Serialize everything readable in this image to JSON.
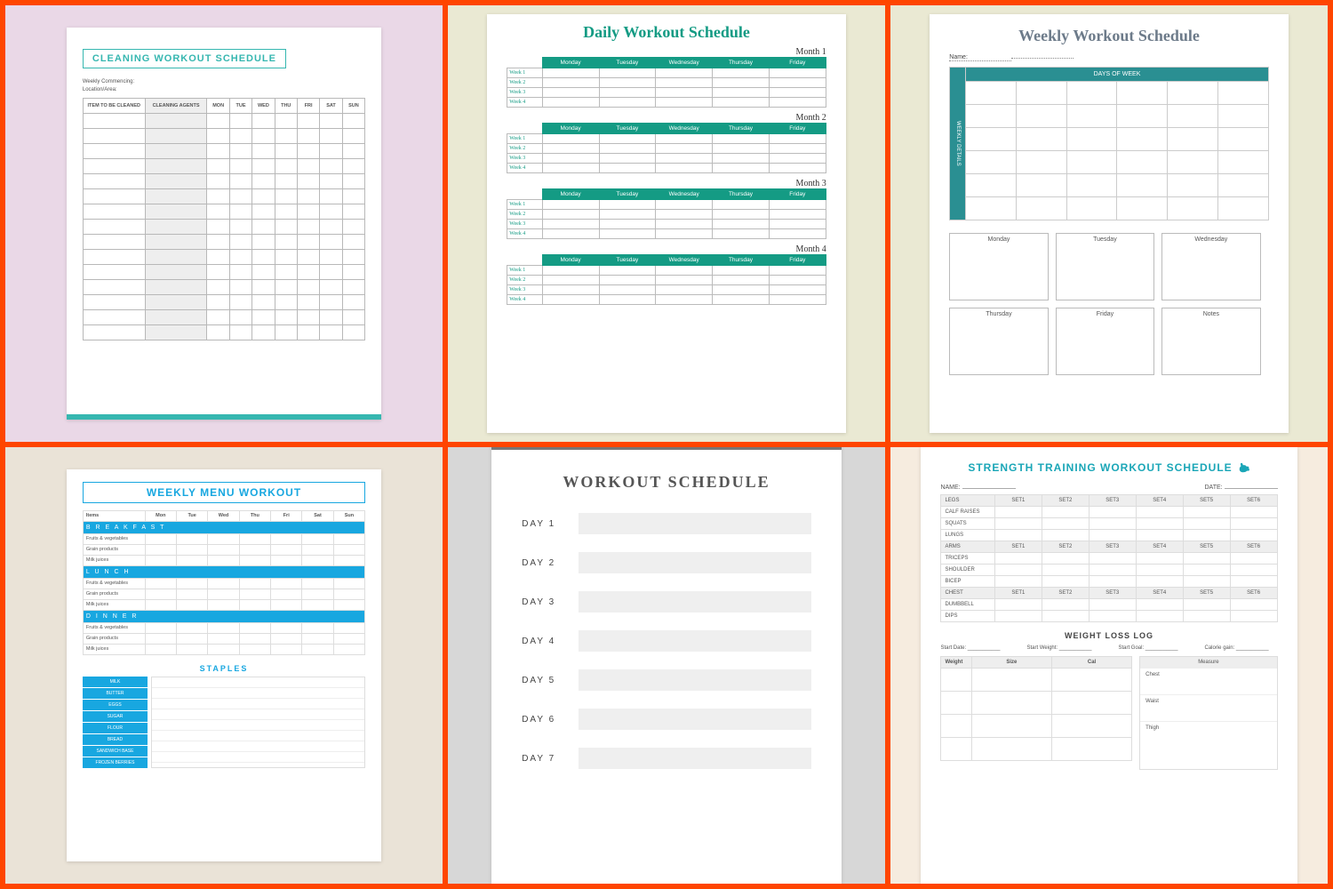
{
  "card1": {
    "title": "CLEANING WORKOUT SCHEDULE",
    "sub1": "Weekly Commencing:",
    "sub2": "Location/Area:",
    "headers": [
      "ITEM TO BE CLEANED",
      "CLEANING AGENTS",
      "MON",
      "TUE",
      "WED",
      "THU",
      "FRI",
      "SAT",
      "SUN"
    ],
    "rows": 15
  },
  "card2": {
    "title": "Daily Workout Schedule",
    "months": [
      "Month 1",
      "Month 2",
      "Month 3",
      "Month 4"
    ],
    "days": [
      "Monday",
      "Tuesday",
      "Wednesday",
      "Thursday",
      "Friday"
    ],
    "weeks": [
      "Week 1",
      "Week 2",
      "Week 3",
      "Week 4"
    ]
  },
  "card3": {
    "title": "Weekly Workout Schedule",
    "name_label": "Name:",
    "table_header": "DAYS OF WEEK",
    "side_label": "WEEKLY DETAILS",
    "boxes": [
      "Monday",
      "Tuesday",
      "Wednesday",
      "Thursday",
      "Friday",
      "Notes"
    ]
  },
  "card4": {
    "title": "WEEKLY MENU WORKOUT",
    "cols": [
      "Items",
      "Mon",
      "Tue",
      "Wed",
      "Thu",
      "Fri",
      "Sat",
      "Sun"
    ],
    "meals": [
      "B R E A K F A S T",
      "L U N C H",
      "D I N N E R"
    ],
    "rows": [
      "Fruits & vegetables",
      "Grain products",
      "Milk juices"
    ],
    "staples_title": "STAPLES",
    "staples": [
      "MILK",
      "BUTTER",
      "EGGS",
      "SUGAR",
      "FLOUR",
      "BREAD",
      "SANDWICH BASE",
      "FROZEN BERRIES"
    ]
  },
  "card5": {
    "title": "WORKOUT SCHEDULE",
    "days": [
      "DAY 1",
      "DAY 2",
      "DAY 3",
      "DAY 4",
      "DAY 5",
      "DAY 6",
      "DAY 7"
    ]
  },
  "card6": {
    "title": "STRENGTH TRAINING WORKOUT SCHEDULE",
    "name": "NAME:",
    "date": "DATE:",
    "sets": [
      "SET1",
      "SET2",
      "SET3",
      "SET4",
      "SET5",
      "SET6"
    ],
    "groups": [
      {
        "name": "LEGS",
        "rows": [
          "CALF RAISES",
          "SQUATS",
          "LUNGS"
        ]
      },
      {
        "name": "ARMS",
        "rows": [
          "TRICEPS",
          "SHOULDER",
          "BICEP"
        ]
      },
      {
        "name": "CHEST",
        "rows": [
          "DUMBBELL",
          "DIPS"
        ]
      }
    ],
    "log_title": "WEIGHT LOSS LOG",
    "log_meta": [
      "Start Date:",
      "Start Weight:",
      "Start Goal:",
      "Calorie gain:"
    ],
    "log_cols": [
      "Weight",
      "Size",
      "Cal"
    ],
    "measure_title": "Measure",
    "measure_rows": [
      "Chest",
      "Waist",
      "Thigh"
    ]
  }
}
